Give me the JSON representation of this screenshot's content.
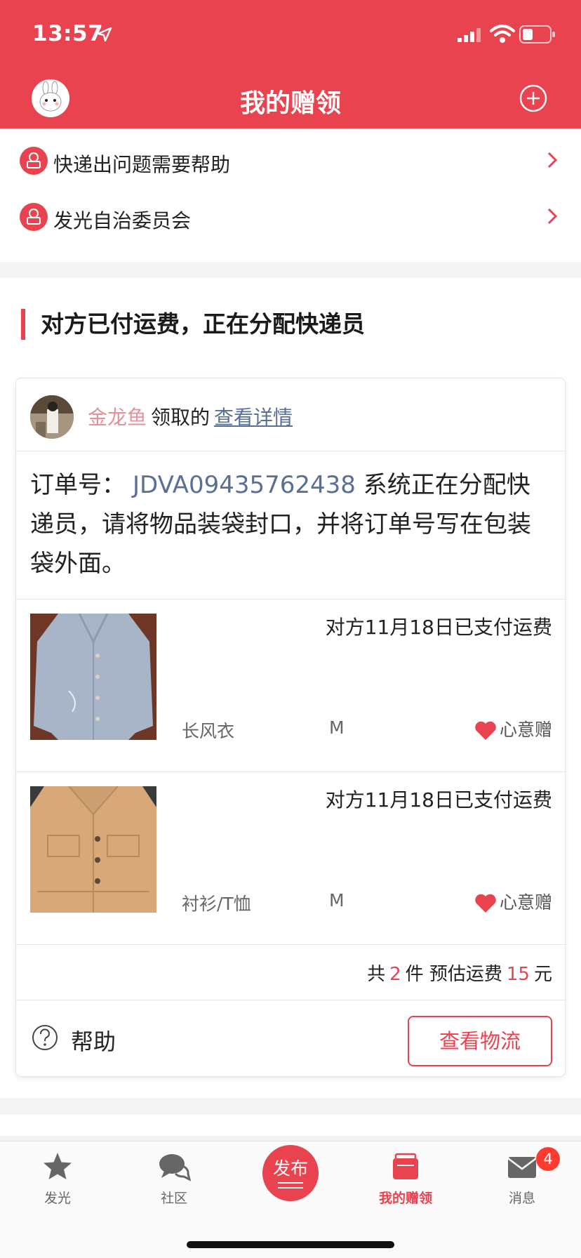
{
  "status_bar": {
    "time": "13:57"
  },
  "header": {
    "title": "我的赠领"
  },
  "help_items": [
    {
      "label": "快递出问题需要帮助"
    },
    {
      "label": "发光自治委员会"
    }
  ],
  "status": {
    "heading": "对方已付运费，正在分配快递员"
  },
  "card": {
    "donor_name": "金龙鱼",
    "claim_text": "领取的",
    "detail_link": "查看详情",
    "order_label": "订单号：",
    "order_no": "JDVA09435762438",
    "order_msg": "系统正在分配快递员，请将物品装袋封口，并将订单号写在包装袋外面。",
    "items": [
      {
        "paid_text": "对方11月18日已支付运费",
        "category": "长风衣",
        "size": "M",
        "tag": "心意赠"
      },
      {
        "paid_text": "对方11月18日已支付运费",
        "category": "衬衫/T恤",
        "size": "M",
        "tag": "心意赠"
      }
    ],
    "summary": {
      "prefix": "共",
      "count": "2",
      "mid": "件 预估运费",
      "fee": "15",
      "suffix": "元"
    },
    "help_label": "帮助",
    "track_button": "查看物流"
  },
  "tabbar": {
    "tabs": [
      {
        "label": "发光",
        "icon": "star-icon"
      },
      {
        "label": "社区",
        "icon": "chat-bubbles-icon"
      },
      {
        "label": "发布",
        "icon": "publish-icon"
      },
      {
        "label": "我的赠领",
        "icon": "wallet-icon",
        "active": true
      },
      {
        "label": "消息",
        "icon": "mail-icon"
      }
    ],
    "badge": "4"
  },
  "colors": {
    "brand": "#e8434f",
    "link": "#5a6f95",
    "donor": "#e89098"
  }
}
